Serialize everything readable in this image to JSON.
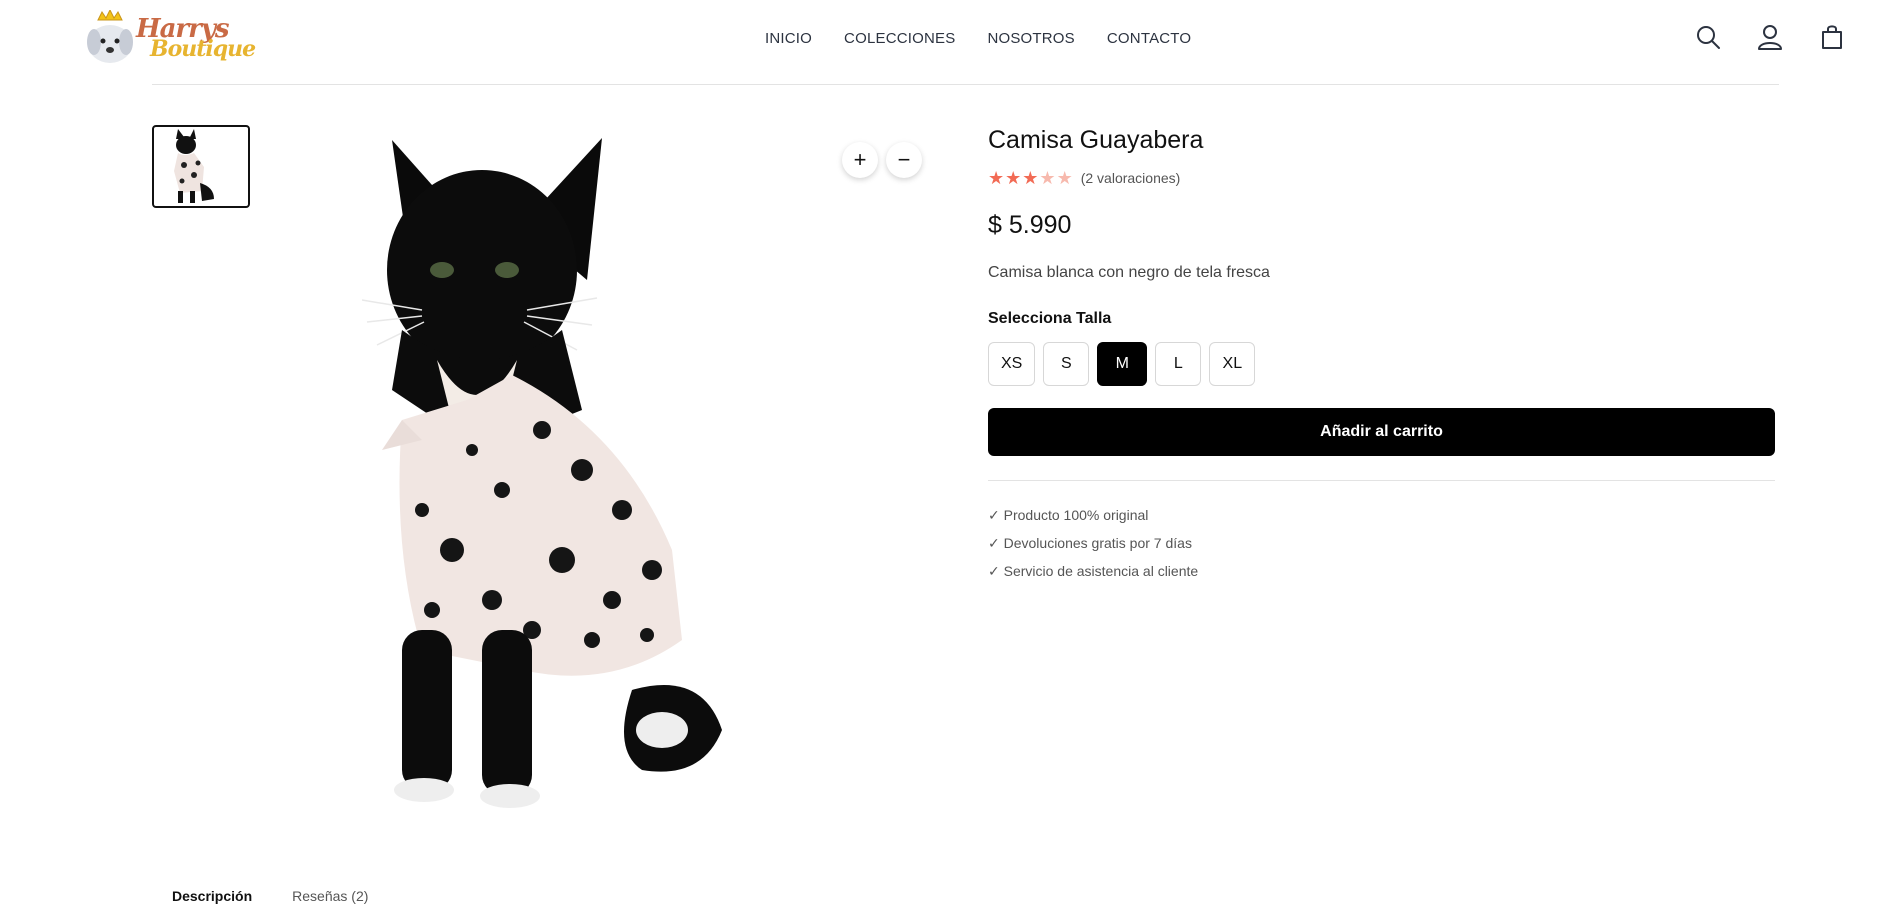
{
  "brand": {
    "logo_line1": "Harrys",
    "logo_line2": "Boutique"
  },
  "nav": {
    "items": [
      {
        "label": "INICIO"
      },
      {
        "label": "COLECCIONES"
      },
      {
        "label": "NOSOTROS"
      },
      {
        "label": "CONTACTO"
      }
    ]
  },
  "header_icons": [
    "search-icon",
    "user-icon",
    "shopping-bag-icon"
  ],
  "gallery": {
    "zoom_in": "+",
    "zoom_out": "−"
  },
  "product": {
    "title": "Camisa Guayabera",
    "rating": 3,
    "rating_max": 5,
    "reviews_label": "(2 valoraciones)",
    "price": "$ 5.990",
    "description": "Camisa blanca con negro de tela fresca",
    "size_label": "Selecciona Talla",
    "sizes": [
      {
        "label": "XS"
      },
      {
        "label": "S"
      },
      {
        "label": "M",
        "selected": true
      },
      {
        "label": "L"
      },
      {
        "label": "XL"
      }
    ],
    "add_to_cart": "Añadir al carrito",
    "features": [
      "✓ Producto 100% original",
      "✓ Devoluciones gratis por 7 días",
      "✓ Servicio de asistencia al cliente"
    ]
  },
  "tabs": [
    {
      "label": "Descripción",
      "active": true
    },
    {
      "label": "Reseñas (2)"
    }
  ],
  "colors": {
    "star_on": "#f26b55",
    "star_off": "#f7b9ad",
    "primary_button": "#000000"
  }
}
